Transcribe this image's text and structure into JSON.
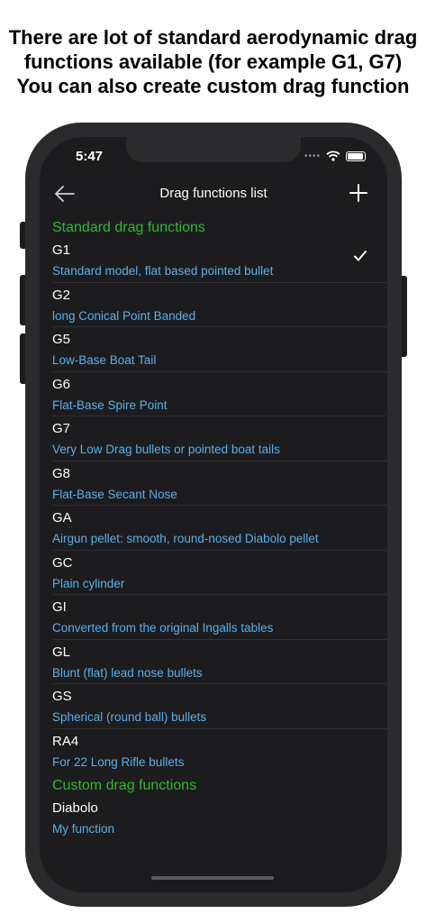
{
  "caption": [
    "There are lot of standard aerodynamic drag",
    "functions available (for example G1, G7)",
    "You can also create custom drag function"
  ],
  "status": {
    "time": "5:47",
    "dots": "••••"
  },
  "nav": {
    "title": "Drag functions list",
    "back_icon": "arrow-left-icon",
    "add_icon": "plus-icon"
  },
  "standard_section": "Standard drag functions",
  "standard": [
    {
      "name": "G1",
      "desc": "Standard model, flat based pointed bullet",
      "selected": true
    },
    {
      "name": "G2",
      "desc": "long Conical Point Banded"
    },
    {
      "name": "G5",
      "desc": "Low-Base Boat Tail"
    },
    {
      "name": "G6",
      "desc": "Flat-Base Spire Point"
    },
    {
      "name": "G7",
      "desc": "Very Low Drag bullets or pointed boat tails"
    },
    {
      "name": "G8",
      "desc": "Flat-Base Secant Nose"
    },
    {
      "name": "GA",
      "desc": "Airgun pellet: smooth, round-nosed Diabolo pellet"
    },
    {
      "name": "GC",
      "desc": "Plain cylinder"
    },
    {
      "name": "GI",
      "desc": "Converted from the original Ingalls tables"
    },
    {
      "name": "GL",
      "desc": "Blunt (flat) lead nose bullets"
    },
    {
      "name": "GS",
      "desc": "Spherical (round ball) bullets"
    },
    {
      "name": "RA4",
      "desc": "For 22 Long Rifle bullets"
    }
  ],
  "custom_section": "Custom drag functions",
  "custom": [
    {
      "name": "Diabolo",
      "desc": "My function"
    }
  ],
  "colors": {
    "accent_green": "#2eb82e",
    "link_blue": "#5aaee8",
    "background": "#1c1c1e"
  }
}
